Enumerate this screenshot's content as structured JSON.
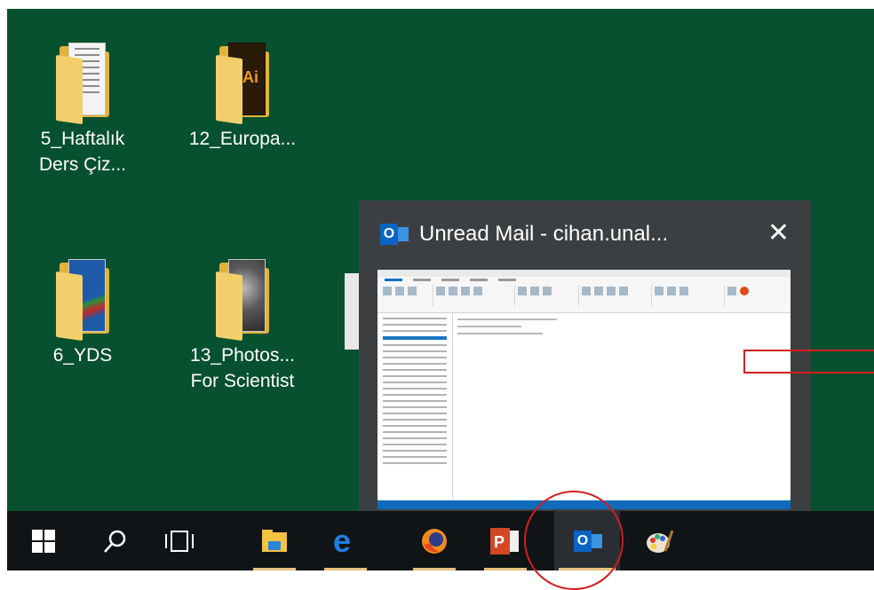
{
  "desktop": {
    "background": "#075030",
    "icons": [
      {
        "label_line1": "5_Haftalık",
        "label_line2": "Ders Çiz...",
        "icon": "folder-document-icon"
      },
      {
        "label_line1": "12_Europa...",
        "label_line2": "",
        "icon": "folder-illustrator-icon"
      },
      {
        "label_line1": "6_YDS",
        "label_line2": "",
        "icon": "folder-book-icon"
      },
      {
        "label_line1": "13_Photos...",
        "label_line2": "For Scientist",
        "icon": "folder-photo-icon"
      }
    ]
  },
  "preview": {
    "app_icon": "outlook-icon",
    "title": "Unread Mail - cihan.unal...",
    "close_glyph": "✕"
  },
  "taskbar": {
    "items": [
      {
        "name": "start-button",
        "icon": "windows-icon"
      },
      {
        "name": "search-button",
        "icon": "search-icon"
      },
      {
        "name": "task-view-button",
        "icon": "task-view-icon"
      },
      {
        "name": "file-explorer-button",
        "icon": "file-explorer-icon"
      },
      {
        "name": "edge-button",
        "icon": "edge-icon"
      },
      {
        "name": "firefox-button",
        "icon": "firefox-icon"
      },
      {
        "name": "powerpoint-button",
        "icon": "powerpoint-icon"
      },
      {
        "name": "outlook-button",
        "icon": "outlook-icon"
      },
      {
        "name": "paint-button",
        "icon": "paint-icon"
      }
    ]
  },
  "colors": {
    "annotation_red": "#d21e1e",
    "outlook_blue": "#0a64c4",
    "taskbar_underline": "#e9c07a"
  }
}
